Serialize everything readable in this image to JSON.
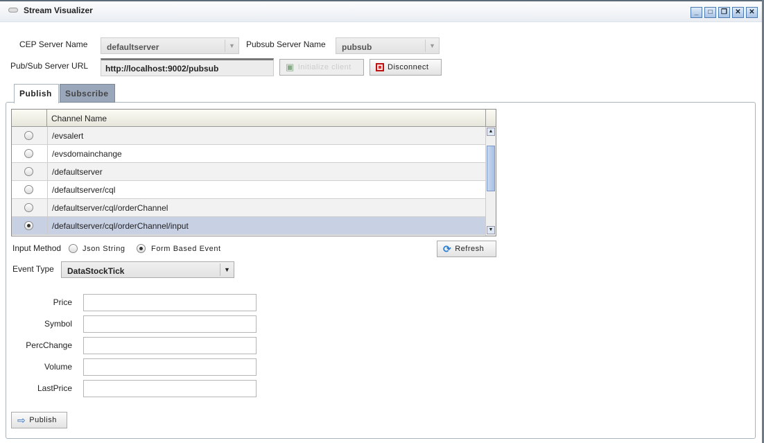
{
  "window": {
    "title": "Stream Visualizer",
    "controls": [
      "minimize",
      "maximize",
      "restore",
      "close-all",
      "close"
    ]
  },
  "connection": {
    "cep_server_label": "CEP Server Name",
    "cep_server_value": "defaultserver",
    "pubsub_server_label": "Pubsub Server Name",
    "pubsub_server_value": "pubsub",
    "url_label": "Pub/Sub Server URL",
    "url_value": "http://localhost:9002/pubsub",
    "init_label": "Initialize client",
    "disconnect_label": "Disconnect"
  },
  "tabs": [
    {
      "label": "Publish",
      "active": true
    },
    {
      "label": "Subscribe",
      "active": false
    }
  ],
  "channels": {
    "header": "Channel Name",
    "rows": [
      {
        "name": "/evsalert",
        "selected": false
      },
      {
        "name": "/evsdomainchange",
        "selected": false
      },
      {
        "name": "/defaultserver",
        "selected": false
      },
      {
        "name": "/defaultserver/cql",
        "selected": false
      },
      {
        "name": "/defaultserver/cql/orderChannel",
        "selected": false
      },
      {
        "name": "/defaultserver/cql/orderChannel/input",
        "selected": true
      }
    ]
  },
  "input_method": {
    "label": "Input Method",
    "options": [
      "Json String",
      "Form Based Event"
    ],
    "selected": "Form Based Event"
  },
  "refresh_label": "Refresh",
  "event_type": {
    "label": "Event Type",
    "value": "DataStockTick"
  },
  "fields": [
    {
      "label": "Price",
      "value": ""
    },
    {
      "label": "Symbol",
      "value": ""
    },
    {
      "label": "PercChange",
      "value": ""
    },
    {
      "label": "Volume",
      "value": ""
    },
    {
      "label": "LastPrice",
      "value": ""
    }
  ],
  "publish_label": "Publish"
}
